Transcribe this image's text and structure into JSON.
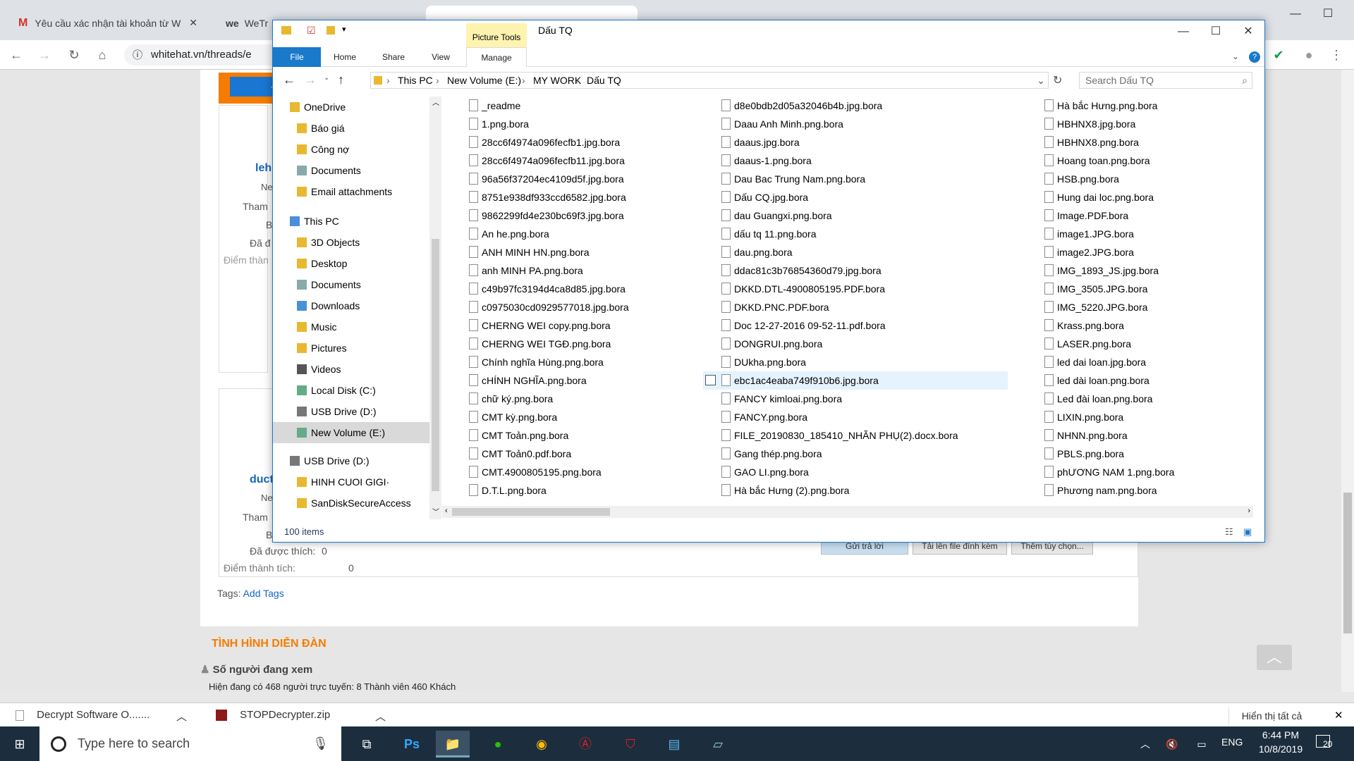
{
  "chrome": {
    "tabs": [
      {
        "title": "Yêu cầu xác nhận tài khoản từ W",
        "icon": "gmail-icon"
      },
      {
        "title": "WeTr",
        "icon": "wetransfer-icon"
      }
    ],
    "url": "whitehat.vn/threads/e"
  },
  "forum": {
    "user1": "leh",
    "user2": "duct",
    "ne": "Ne",
    "tham": "Tham",
    "b": "B",
    "da": "Đã đ",
    "diem_partial": "Điểm thàn",
    "liked_label": "Đã được thích:",
    "liked_value": "0",
    "points_label": "Điểm thành tích:",
    "points_value": "0",
    "tags_label": "Tags:",
    "add_tags": "Add Tags",
    "btn_reply": "Gửi trả lời",
    "btn_upload": "Tải lên file đính kèm",
    "btn_more": "Thêm tùy chọn...",
    "section_title": "TÌNH HÌNH DIỄN ĐÀN",
    "viewers_title": "Số người đang xem",
    "viewers_text": "Hiện đang có 468 người trực tuyến: 8 Thành viên 460 Khách"
  },
  "explorer": {
    "picture_tools": "Picture Tools",
    "title": "Dấu TQ",
    "ribbon_tabs": [
      "File",
      "Home",
      "Share",
      "View",
      "Manage"
    ],
    "breadcrumb": [
      "This PC",
      "New Volume (E:)",
      "MY WORK",
      "Dấu TQ"
    ],
    "search_placeholder": "Search Dấu TQ",
    "nav": [
      {
        "label": "OneDrive",
        "level": 0
      },
      {
        "label": "Báo giá",
        "level": 1
      },
      {
        "label": "Công nợ",
        "level": 1
      },
      {
        "label": "Documents",
        "level": 1
      },
      {
        "label": "Email attachments",
        "level": 1
      },
      {
        "label": "This PC",
        "level": 0
      },
      {
        "label": "3D Objects",
        "level": 1
      },
      {
        "label": "Desktop",
        "level": 1
      },
      {
        "label": "Documents",
        "level": 1
      },
      {
        "label": "Downloads",
        "level": 1
      },
      {
        "label": "Music",
        "level": 1
      },
      {
        "label": "Pictures",
        "level": 1
      },
      {
        "label": "Videos",
        "level": 1
      },
      {
        "label": "Local Disk (C:)",
        "level": 1
      },
      {
        "label": "USB Drive (D:)",
        "level": 1
      },
      {
        "label": "New Volume (E:)",
        "level": 1
      },
      {
        "label": "USB Drive (D:)",
        "level": 0
      },
      {
        "label": "HINH CUOI GIGI·",
        "level": 1
      },
      {
        "label": "SanDiskSecureAccess",
        "level": 1
      }
    ],
    "files_col1": [
      "_readme",
      "1.png.bora",
      "28cc6f4974a096fecfb1.jpg.bora",
      "28cc6f4974a096fecfb11.jpg.bora",
      "96a56f37204ec4109d5f.jpg.bora",
      "8751e938df933ccd6582.jpg.bora",
      "9862299fd4e230bc69f3.jpg.bora",
      "An he.png.bora",
      "ANH MINH HN.png.bora",
      "anh MINH PA.png.bora",
      "c49b97fc3194d4ca8d85.jpg.bora",
      "c0975030cd0929577018.jpg.bora",
      "CHERNG WEI copy.png.bora",
      "CHERNG WEI TGĐ.png.bora",
      "Chính nghĩa Hùng.png.bora",
      "cHÍNH NGHĨA.png.bora",
      "chữ ký.png.bora",
      "CMT kỳ.png.bora",
      "CMT Toản.png.bora",
      "CMT Toản0.pdf.bora",
      "CMT.4900805195.png.bora",
      "D.T.L.png.bora"
    ],
    "files_col2": [
      "d8e0bdb2d05a32046b4b.jpg.bora",
      "Daau Anh Minh.png.bora",
      "daaus.jpg.bora",
      "daaus-1.png.bora",
      "Dau Bac Trung Nam.png.bora",
      "Dấu CQ.jpg.bora",
      "dau Guangxi.png.bora",
      "dấu tq 11.png.bora",
      "dau.png.bora",
      "ddac81c3b76854360d79.jpg.bora",
      "DKKD.DTL-4900805195.PDF.bora",
      "DKKD.PNC.PDF.bora",
      "Doc 12-27-2016 09-52-11.pdf.bora",
      "DONGRUI.png.bora",
      "DUkha.png.bora",
      "ebc1ac4eaba749f910b6.jpg.bora",
      "FANCY kimloai.png.bora",
      "FANCY.png.bora",
      "FILE_20190830_185410_NHÃN PHỤ(2).docx.bora",
      "Gang thép.png.bora",
      "GAO LI.png.bora",
      "Hà bắc Hưng (2).png.bora"
    ],
    "files_col3": [
      "Hà bắc Hưng.png.bora",
      "HBHNX8.jpg.bora",
      "HBHNX8.png.bora",
      "Hoang toan.png.bora",
      "HSB.png.bora",
      "Hung dai loc.png.bora",
      "Image.PDF.bora",
      "image1.JPG.bora",
      "image2.JPG.bora",
      "IMG_1893_JS.jpg.bora",
      "IMG_3505.JPG.bora",
      "IMG_5220.JPG.bora",
      "Krass.png.bora",
      "LASER.png.bora",
      "led dai loan.jpg.bora",
      "led dài loan.png.bora",
      "Led đài loan.png.bora",
      "LIXIN.png.bora",
      "NHNN.png.bora",
      "PBLS.png.bora",
      "phƯƠNG NAM 1.png.bora",
      "Phương nam.png.bora"
    ],
    "status": "100 items"
  },
  "downloads": {
    "item1": "Decrypt Software O.......",
    "item2": "STOPDecrypter.zip",
    "show_all": "Hiển thị tất cả"
  },
  "taskbar": {
    "search": "Type here to search",
    "lang": "ENG",
    "time": "6:44 PM",
    "date": "10/8/2019",
    "notif": "20"
  }
}
